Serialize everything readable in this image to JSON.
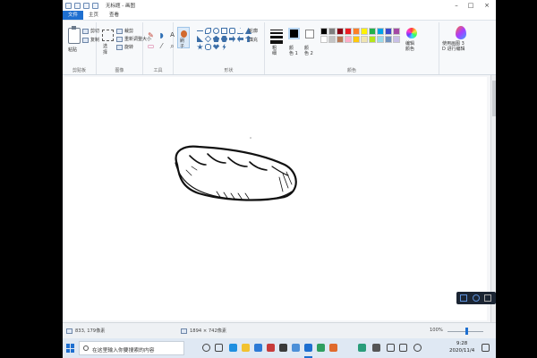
{
  "window": {
    "title": "无标题 - 画图"
  },
  "tabs": [
    "文件",
    "主页",
    "查看"
  ],
  "ribbon": {
    "clipboard": {
      "paste": "粘贴",
      "cut": "剪切",
      "copy": "复制",
      "label": "剪贴板"
    },
    "image": {
      "select": "选\n择",
      "crop": "裁剪",
      "resize": "重新调整大小",
      "rotate": "旋转",
      "label": "图像"
    },
    "tools": {
      "label": "工具"
    },
    "brushes": {
      "label": "刷\n子"
    },
    "shapes": {
      "outline": "轮廓",
      "fill": "填充",
      "label": "形状"
    },
    "colors": {
      "size": "粗\n细",
      "color1": "颜\n色 1",
      "color2": "颜\n色 2",
      "edit": "编辑\n颜色",
      "paint3d": "使用画图 3\nD 进行编辑",
      "label": "颜色",
      "palette": [
        "#000000",
        "#7f7f7f",
        "#880015",
        "#ed1c24",
        "#ff7f27",
        "#fff200",
        "#22b14c",
        "#00a2e8",
        "#3f48cc",
        "#a349a4",
        "#ffffff",
        "#c3c3c3",
        "#b97a57",
        "#ffaec9",
        "#ffc90e",
        "#efe4b0",
        "#b5e61d",
        "#99d9ea",
        "#7092be",
        "#c8bfe7"
      ]
    }
  },
  "status": {
    "cursor": "833, 179像素",
    "canvas_size": "1894 × 742像素",
    "zoom": "100%"
  },
  "taskbar": {
    "search_placeholder": "在这里输入你要搜索的内容",
    "time": "9:28",
    "date": "2020/11/4"
  }
}
